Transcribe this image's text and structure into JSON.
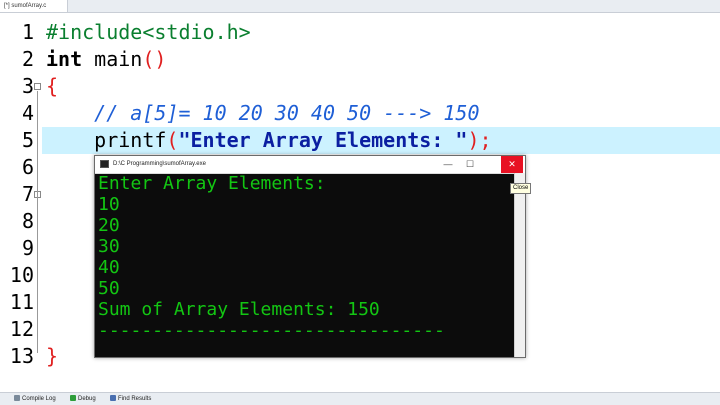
{
  "editor_tab": {
    "label": "[*] sumofArray.c"
  },
  "line_numbers": [
    "1",
    "2",
    "3",
    "4",
    "5",
    "6",
    "7",
    "8",
    "9",
    "10",
    "11",
    "12",
    "13"
  ],
  "code": {
    "line1": "#include<stdio.h>",
    "line2_kw": "int",
    "line2_rest": " main",
    "line2_parens": "()",
    "line3": "{",
    "line4_comment": "// a[5]= 10 20 30 40 50 ---> 150",
    "line5_func": "printf",
    "line5_open": "(",
    "line5_string": "\"Enter Array Elements: \"",
    "line5_close": ");",
    "line13": "}"
  },
  "console": {
    "title": "D:\\C Programming\\sumofArray.exe",
    "minimize_label": "—",
    "maximize_label": "☐",
    "close_label": "✕",
    "lines": [
      "Enter Array Elements:",
      "10",
      "20",
      "30",
      "40",
      "50",
      "Sum of Array Elements: 150",
      "--------------------------------"
    ]
  },
  "tooltip": {
    "text": "Close"
  },
  "bottom_tabs": [
    {
      "label": "Compile Log",
      "icon": "compile-log-icon",
      "color": "#7a8a9a"
    },
    {
      "label": "Debug",
      "icon": "debug-check-icon",
      "color": "#2e9d3a"
    },
    {
      "label": "Find Results",
      "icon": "find-results-icon",
      "color": "#4a6fb0"
    }
  ],
  "colors": {
    "highlight_line": "#ccf2ff",
    "console_text": "#13c613",
    "preprocessor": "#0a7f2f",
    "comment": "#1f5fd6",
    "string": "#0b1fa1",
    "paren": "#e02020"
  }
}
